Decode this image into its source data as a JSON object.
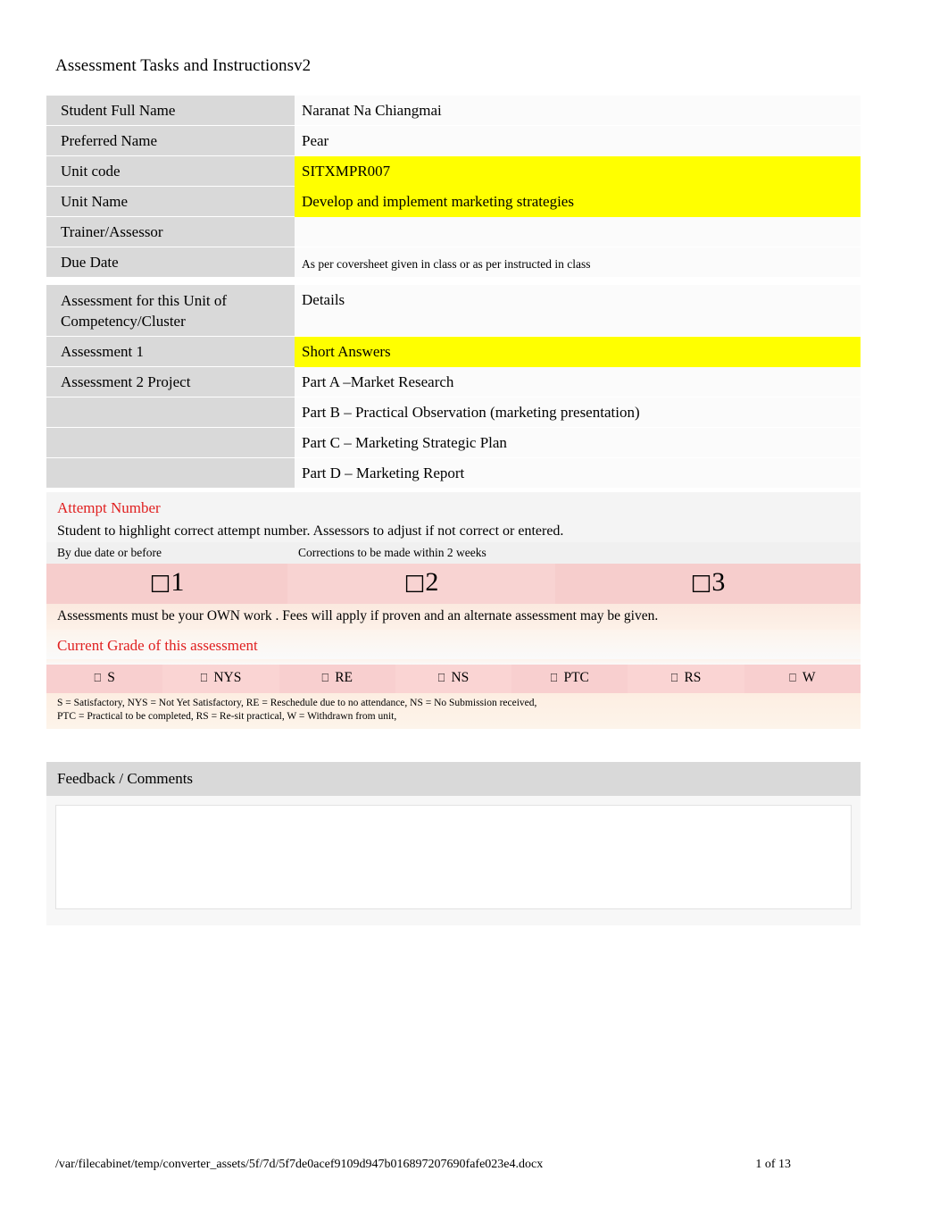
{
  "document": {
    "title": "Assessment Tasks and Instructionsv2"
  },
  "student_table": {
    "rows": [
      {
        "label": "Student Full Name",
        "value": "Naranat Na Chiangmai",
        "highlight": false
      },
      {
        "label": "Preferred Name",
        "value": "Pear",
        "highlight": false
      },
      {
        "label": "Unit code",
        "value": "SITXMPR007",
        "highlight": true
      },
      {
        "label": "Unit Name",
        "value": "Develop and implement marketing strategies",
        "highlight": true
      },
      {
        "label": "Trainer/Assessor",
        "value": "",
        "highlight": false
      },
      {
        "label": "Due Date",
        "value": "As per coversheet given in class or as per instructed in class",
        "highlight": false
      }
    ]
  },
  "assessment_table": {
    "header_label": "Assessment for this Unit of Competency/Cluster",
    "header_value": "Details",
    "rows": [
      {
        "label": "Assessment 1",
        "value": "Short Answers",
        "highlight": true
      },
      {
        "label": "Assessment 2 Project",
        "value": "Part A –Market Research",
        "highlight": false
      },
      {
        "label": "",
        "value": "Part B – Practical Observation (marketing presentation)",
        "highlight": false
      },
      {
        "label": "",
        "value": "Part C – Marketing Strategic Plan",
        "highlight": false
      },
      {
        "label": "",
        "value": "Part D – Marketing Report",
        "highlight": false
      }
    ]
  },
  "attempt": {
    "heading": "Attempt Number",
    "instruction": "Student to highlight correct attempt number. Assessors to adjust if not correct or entered.",
    "sub_labels": [
      "By due date or before",
      "Corrections to be made within 2 weeks",
      ""
    ],
    "options": [
      {
        "checkbox": "□",
        "number": "1"
      },
      {
        "checkbox": "□",
        "number": "2"
      },
      {
        "checkbox": "□",
        "number": "3"
      }
    ],
    "own_work_note": "Assessments must be your OWN work . Fees will apply if proven and an alternate assessment may be given."
  },
  "grade": {
    "heading": "Current Grade of this assessment",
    "options": [
      {
        "checkbox": "⎕",
        "label": "S"
      },
      {
        "checkbox": "⎕",
        "label": "NYS"
      },
      {
        "checkbox": "⎕",
        "label": "RE"
      },
      {
        "checkbox": "⎕",
        "label": "NS"
      },
      {
        "checkbox": "⎕",
        "label": "PTC"
      },
      {
        "checkbox": "⎕",
        "label": "RS"
      },
      {
        "checkbox": "⎕",
        "label": "W"
      }
    ],
    "legend_line_1": "S = Satisfactory, NYS = Not Yet Satisfactory, RE = Reschedule due to no attendance, NS = No Submission received,",
    "legend_line_2": "PTC = Practical to be completed, RS = Re-sit practical, W = Withdrawn from unit,"
  },
  "feedback": {
    "heading": "Feedback / Comments",
    "content": ""
  },
  "footer": {
    "path": "/var/filecabinet/temp/converter_assets/5f/7d/5f7de0acef9109d947b016897207690fafe023e4.docx",
    "page": "1 of 13"
  },
  "colors": {
    "highlight_yellow": "#ffff00",
    "label_gray": "#d9d9d9",
    "heading_red": "#e02020",
    "attempt_pink": "#f6cdcc",
    "grade_pink": "#f8cfcf",
    "note_cream": "#fbe9df"
  }
}
